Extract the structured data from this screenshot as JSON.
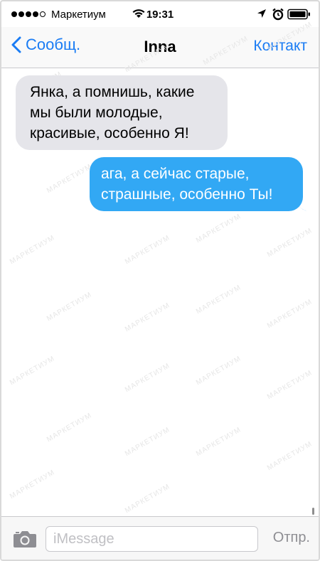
{
  "status_bar": {
    "carrier": "Маркетиум",
    "time": "19:31"
  },
  "nav": {
    "back_label": "Сообщ.",
    "title": "Inna",
    "contact_label": "Контакт"
  },
  "messages": [
    {
      "direction": "incoming",
      "text": "Янка, а помнишь, какие мы были молодые, красивые, особенно Я!"
    },
    {
      "direction": "outgoing",
      "text": "ага, а сейчас старые, страшные, особенно Ты!"
    }
  ],
  "watermark": "МАРКЕТИУМ",
  "input": {
    "placeholder": "iMessage",
    "value": ""
  },
  "send_label": "Отпр.",
  "colors": {
    "accent": "#1a7cf4",
    "incoming_bubble": "#e5e5ea",
    "outgoing_bubble": "#32a8f4"
  }
}
